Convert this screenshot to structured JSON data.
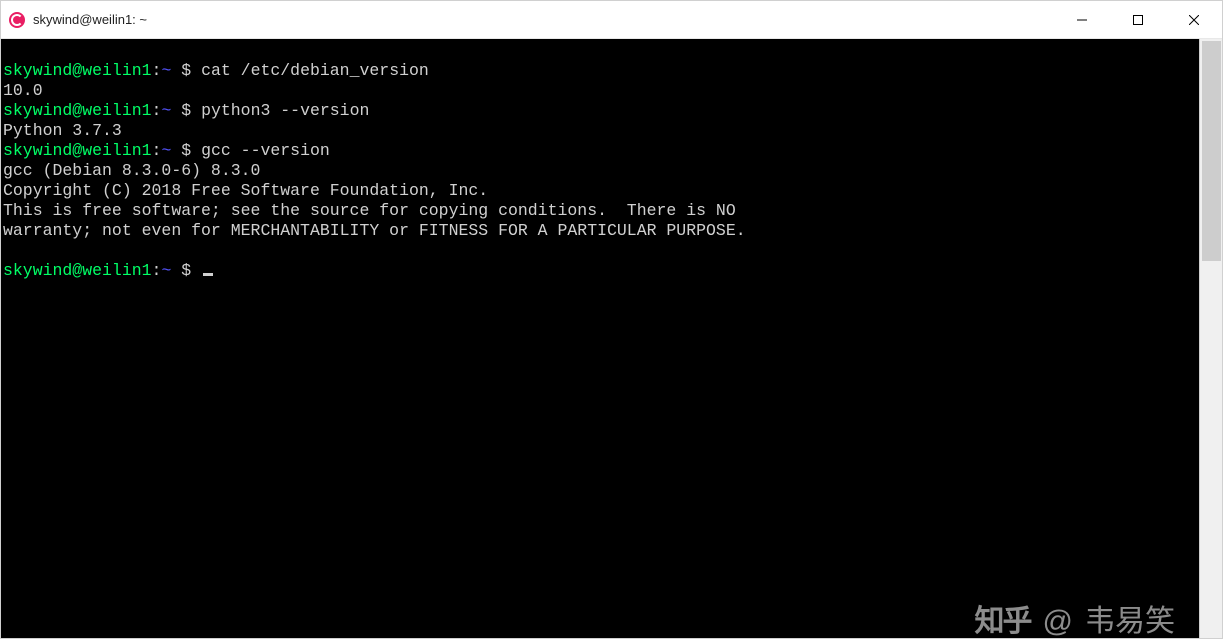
{
  "window": {
    "title": "skywind@weilin1: ~"
  },
  "prompt": {
    "user_host": "skywind@weilin1",
    "path": "~",
    "symbol": "$"
  },
  "lines": [
    {
      "cmd": "cat /etc/debian_version"
    },
    {
      "out": "10.0"
    },
    {
      "cmd": "python3 --version"
    },
    {
      "out": "Python 3.7.3"
    },
    {
      "cmd": "gcc --version"
    },
    {
      "out": "gcc (Debian 8.3.0-6) 8.3.0"
    },
    {
      "out": "Copyright (C) 2018 Free Software Foundation, Inc."
    },
    {
      "out": "This is free software; see the source for copying conditions.  There is NO"
    },
    {
      "out": "warranty; not even for MERCHANTABILITY or FITNESS FOR A PARTICULAR PURPOSE."
    },
    {
      "out": ""
    }
  ],
  "watermark": {
    "logo": "知乎",
    "at": "@",
    "author": "韦易笑"
  }
}
